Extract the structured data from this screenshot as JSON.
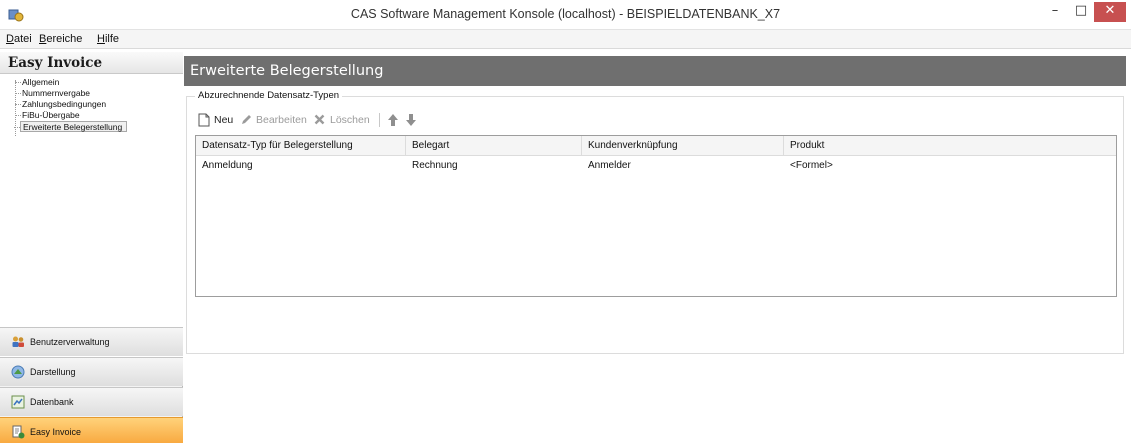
{
  "window": {
    "title": "CAS Software Management Konsole (localhost) - BEISPIELDATENBANK_X7",
    "minimize": "–",
    "maximize": "□",
    "close": "✕"
  },
  "menu": [
    {
      "first": "D",
      "rest": "atei"
    },
    {
      "first": "B",
      "rest": "ereiche"
    },
    {
      "first": "H",
      "rest": "ilfe"
    }
  ],
  "left_panel": {
    "title": "Easy Invoice",
    "tree": [
      "Allgemein",
      "Nummernvergabe",
      "Zahlungsbedingungen",
      "FiBu-Übergabe",
      "Erweiterte Belegerstellung"
    ],
    "splitter": "::::::::::",
    "nav": [
      "Benutzerverwaltung",
      "Darstellung",
      "Datenbank",
      "Easy Invoice"
    ]
  },
  "main": {
    "header": "Erweiterte Belegerstellung",
    "group_title": "Abzurechnende Datensatz-Typen",
    "toolbar": {
      "new": "Neu",
      "edit": "Bearbeiten",
      "delete": "Löschen"
    },
    "grid": {
      "columns": [
        "Datensatz-Typ für Belegerstellung",
        "Belegart",
        "Kundenverknüpfung",
        "Produkt"
      ],
      "rows": [
        [
          "Anmeldung",
          "Rechnung",
          "Anmelder",
          "<Formel>"
        ]
      ]
    }
  },
  "colors": {
    "header_bg": "#6f6f6f",
    "active_nav": "#f8a53a",
    "close_button": "#c75050"
  },
  "icons": [
    "app-icon",
    "new-doc-icon",
    "pencil-icon",
    "delete-x-icon",
    "arrow-up-icon",
    "arrow-down-icon",
    "users-icon",
    "display-icon",
    "database-icon",
    "easy-invoice-icon"
  ]
}
